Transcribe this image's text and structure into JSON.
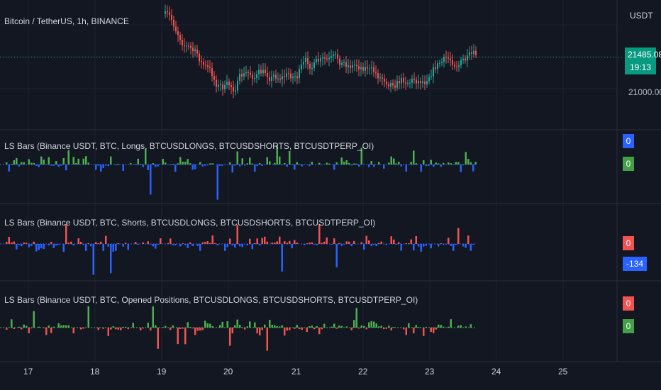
{
  "header": {
    "title": "Bitcoin / TetherUS, 1h, BINANCE"
  },
  "price_axis": {
    "currency": "USDT",
    "last_price": "21485.08",
    "countdown": "19:13",
    "tick": "21000.00"
  },
  "panes": [
    {
      "title": "LS Bars (Binance USDT, BTC, Longs, BTCUSDLONGS, BTCUSDSHORTS, BTCUSDTPERP_OI)",
      "tags": [
        "0",
        "0"
      ]
    },
    {
      "title": "LS Bars (Binance USDT, BTC, Shorts, BTCUSDLONGS, BTCUSDSHORTS, BTCUSDTPERP_OI)",
      "tags": [
        "0",
        "-134"
      ]
    },
    {
      "title": "LS Bars (Binance USDT, BTC, Opened Positions, BTCUSDLONGS, BTCUSDSHORTS, BTCUSDTPERP_OI)",
      "tags": [
        "0",
        "0"
      ]
    }
  ],
  "time_axis": [
    "17",
    "18",
    "19",
    "20",
    "21",
    "22",
    "23",
    "24",
    "25"
  ],
  "colors": {
    "bg": "#131722",
    "grid": "#2a2e39",
    "up": "#26a69a",
    "down": "#ef5350",
    "green": "#4caf50",
    "red": "#f05350",
    "blue": "#2962ff",
    "price_tag": "#089981"
  }
}
